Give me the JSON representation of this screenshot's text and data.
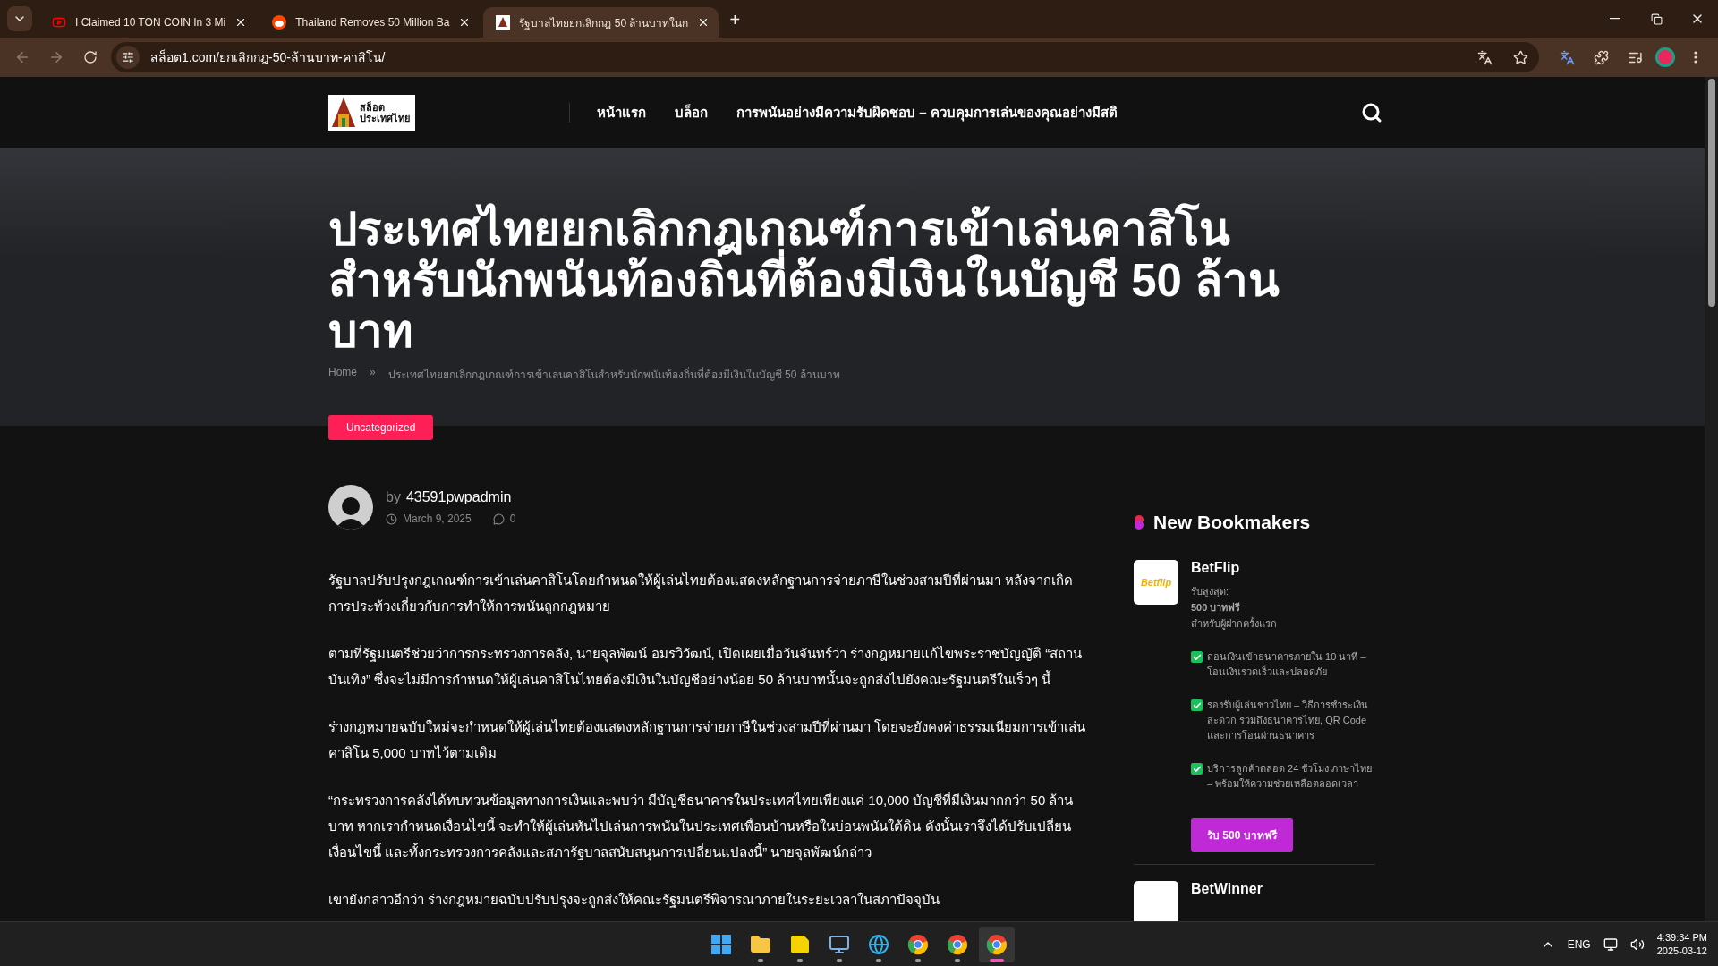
{
  "browser": {
    "tabs": [
      {
        "kind": "video",
        "title": "I Claimed 10 TON COIN In 3 Mi",
        "selected": false
      },
      {
        "kind": "forum",
        "title": "Thailand Removes 50 Million Ba",
        "selected": false
      },
      {
        "kind": "site",
        "title": "รัฐบาลไทยยกเลิกกฎ 50 ล้านบาทในก",
        "selected": true
      }
    ],
    "new_tab": "+",
    "address": "สล็อต1.com/ยกเลิกกฎ-50-ล้านบาท-คาสิโน/"
  },
  "site": {
    "logo": [
      "สล็อต",
      "ประเทศไทย"
    ],
    "nav": [
      "หน้าแรก",
      "บล็อก",
      "การพนันอย่างมีความรับผิดชอบ – ควบคุมการเล่นของคุณอย่างมีสติ"
    ]
  },
  "hero": {
    "title": "ประเทศไทยยกเลิกกฎเกณฑ์การเข้าเล่นคาสิโนสำหรับนักพนันท้องถิ่นที่ต้องมีเงินในบัญชี 50 ล้านบาท",
    "breadcrumb": {
      "home": "Home",
      "separator": "»",
      "current": "ประเทศไทยยกเลิกกฎเกณฑ์การเข้าเล่นคาสิโนสำหรับนักพนันท้องถิ่นที่ต้องมีเงินในบัญชี 50 ล้านบาท"
    }
  },
  "category": "Uncategorized",
  "author": {
    "by": "by",
    "name": "43591pwpadmin",
    "date": "March 9, 2025",
    "comments": "0"
  },
  "paragraphs": [
    "รัฐบาลปรับปรุงกฎเกณฑ์การเข้าเล่นคาสิโนโดยกำหนดให้ผู้เล่นไทยต้องแสดงหลักฐานการจ่ายภาษีในช่วงสามปีที่ผ่านมา หลังจากเกิดการประท้วงเกี่ยวกับการทำให้การพนันถูกกฎหมาย",
    "ตามที่รัฐมนตรีช่วยว่าการกระทรวงการคลัง, นายจุลพัฒน์ อมรวิวัฒน์, เปิดเผยเมื่อวันจันทร์ว่า ร่างกฎหมายแก้ไขพระราชบัญญัติ “สถานบันเทิง” ซึ่งจะไม่มีการกำหนดให้ผู้เล่นคาสิโนไทยต้องมีเงินในบัญชีอย่างน้อย 50 ล้านบาทนั้นจะถูกส่งไปยังคณะรัฐมนตรีในเร็วๆ นี้",
    "ร่างกฎหมายฉบับใหม่จะกำหนดให้ผู้เล่นไทยต้องแสดงหลักฐานการจ่ายภาษีในช่วงสามปีที่ผ่านมา โดยจะยังคงค่าธรรมเนียมการเข้าเล่นคาสิโน 5,000 บาทไว้ตามเดิม",
    "“กระทรวงการคลังได้ทบทวนข้อมูลทางการเงินและพบว่า มีบัญชีธนาคารในประเทศไทยเพียงแค่ 10,000 บัญชีที่มีเงินมากกว่า 50 ล้านบาท หากเรากำหนดเงื่อนไขนี้ จะทำให้ผู้เล่นหันไปเล่นการพนันในประเทศเพื่อนบ้านหรือในบ่อนพนันใต้ดิน ดังนั้นเราจึงได้ปรับเปลี่ยนเงื่อนไขนี้ และทั้งกระทรวงการคลังและสภารัฐบาลสนับสนุนการเปลี่ยนแปลงนี้” นายจุลพัฒน์กล่าว",
    "เขายังกล่าวอีกว่า ร่างกฎหมายฉบับปรับปรุงจะถูกส่งให้คณะรัฐมนตรีพิจารณาภายในระยะเวลาในสภาปัจจุบัน"
  ],
  "sidebar": {
    "title": "New Bookmakers",
    "bookmakers": [
      {
        "name": "BetFlip",
        "logo_text": "Betflip",
        "bonus_label": "รับสูงสุด:",
        "bonus": "500 บาทฟรี",
        "bonus_note": "สำหรับผู้ฝากครั้งแรก",
        "features": [
          "ถอนเงินเข้าธนาคารภายใน 10 นาที – โอนเงินรวดเร็วและปลอดภัย",
          "รองรับผู้เล่นชาวไทย – วิธีการชำระเงินสะดวก รวมถึงธนาคารไทย, QR Code และการโอนผ่านธนาคาร",
          "บริการลูกค้าตลอด 24 ชั่วโมง ภาษาไทย – พร้อมให้ความช่วยเหลือตลอดเวลา"
        ],
        "button": "รับ 500 บาทฟรี"
      },
      {
        "name": "BetWinner"
      }
    ]
  },
  "taskbar": {
    "apps": [
      {
        "kind": "start",
        "selected": false
      },
      {
        "kind": "folder",
        "selected": false
      },
      {
        "kind": "notes",
        "selected": false
      },
      {
        "kind": "computer",
        "selected": false
      },
      {
        "kind": "edge",
        "selected": false
      },
      {
        "kind": "chrome",
        "selected": false
      },
      {
        "kind": "chrome",
        "selected": false
      },
      {
        "kind": "chrome",
        "selected": true
      }
    ],
    "language": "ENG",
    "time": "4:39:34 PM",
    "date": "2025-03-12"
  }
}
